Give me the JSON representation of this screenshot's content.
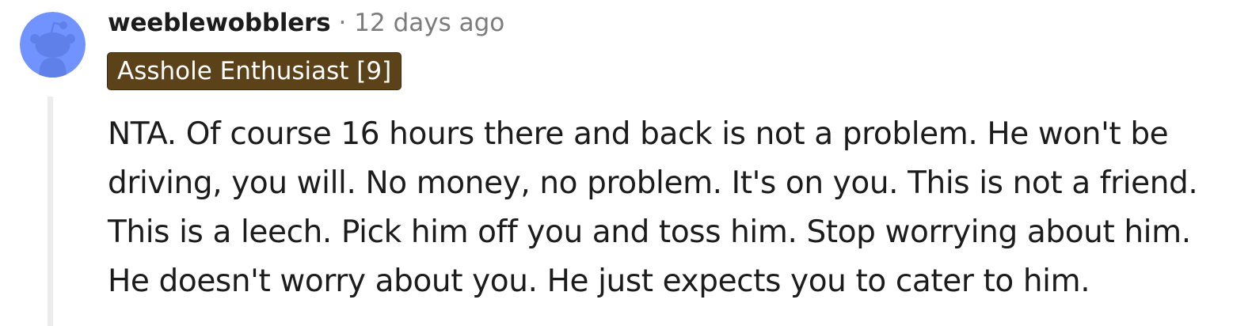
{
  "comment": {
    "author": "weeblewobblers",
    "separator": "·",
    "timestamp": "12 days ago",
    "flair": "Asshole Enthusiast [9]",
    "body_lines": [
      "NTA. Of course 16 hours there and back is not a problem. He won't be",
      "driving, you will. No money, no problem. It's on you. This is not a friend.",
      "This is a leech. Pick him off you and toss him. Stop worrying about him.",
      "He doesn't worry about you. He just expects you to cater to him."
    ]
  },
  "colors": {
    "avatar_background": "#7193ff",
    "avatar_figure": "#5f80e8",
    "flair_background": "#5c4218",
    "thread_line": "#ececec",
    "meta_text": "#7c7c7c",
    "body_text": "#1c1c1c"
  },
  "icons": {
    "avatar": "snoo-avatar-icon"
  }
}
